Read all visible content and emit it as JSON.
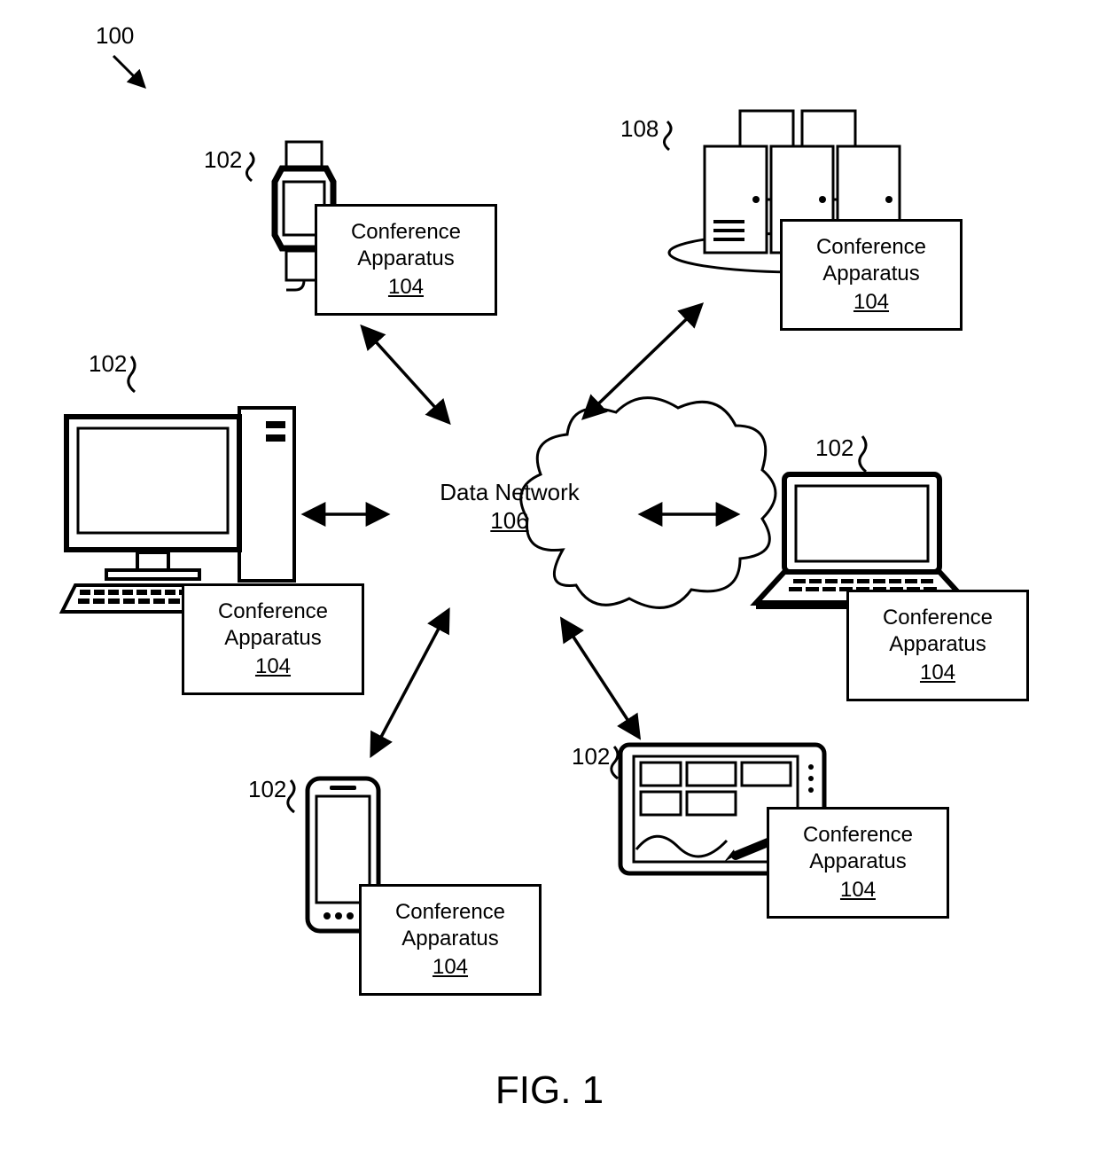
{
  "figure": {
    "caption": "FIG. 1",
    "system_ref": "100"
  },
  "network": {
    "label": "Data Network",
    "ref": "106"
  },
  "apparatus": {
    "label": "Conference Apparatus",
    "ref": "104"
  },
  "refs": {
    "client": "102",
    "server": "108"
  }
}
